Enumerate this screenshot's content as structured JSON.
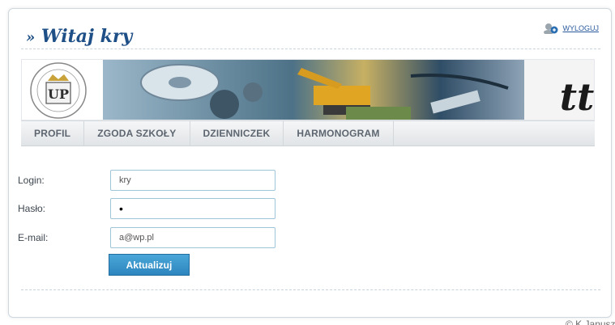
{
  "header": {
    "welcome_prefix": "»",
    "welcome_text": "Witaj kry",
    "logout_label": "WYLOGUJ"
  },
  "banner": {
    "logo_letters": "UP",
    "right_letters": "tt"
  },
  "menu": {
    "items": [
      {
        "label": "PROFIL"
      },
      {
        "label": "ZGODA SZKOŁY"
      },
      {
        "label": "DZIENNICZEK"
      },
      {
        "label": "HARMONOGRAM"
      }
    ]
  },
  "form": {
    "login_label": "Login:",
    "login_value": "kry",
    "password_label": "Hasło:",
    "password_value": "•",
    "email_label": "E-mail:",
    "email_value": "a@wp.pl",
    "submit_label": "Aktualizuj"
  },
  "footer": {
    "copyright": "© K.Janusz"
  },
  "colors": {
    "title": "#1e4f86",
    "button": "#2d86bf",
    "input_border": "#9fc5d9"
  }
}
